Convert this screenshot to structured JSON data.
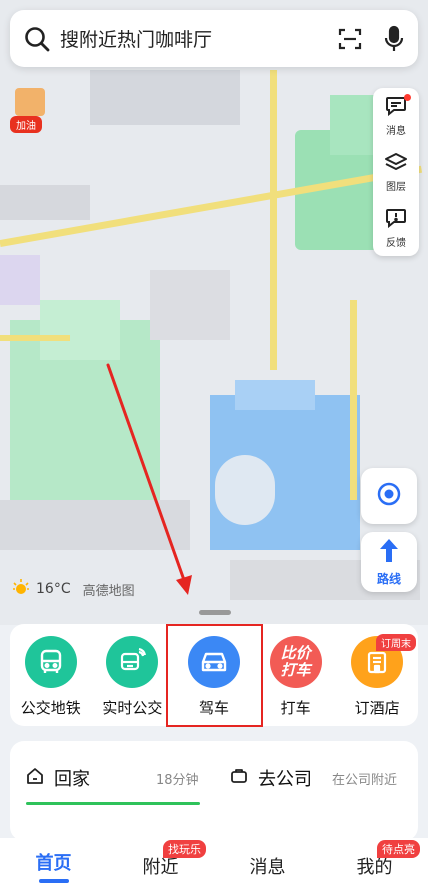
{
  "search": {
    "placeholder": "搜附近热门咖啡厅"
  },
  "map_overlay": {
    "gas_badge": "加油"
  },
  "tools": [
    {
      "label": "消息",
      "icon": "message-icon",
      "has_dot": true
    },
    {
      "label": "图层",
      "icon": "layers-icon"
    },
    {
      "label": "反馈",
      "icon": "feedback-icon"
    }
  ],
  "route_button": {
    "label": "路线"
  },
  "weather": {
    "temperature": "16°C",
    "brand": "高德地图"
  },
  "quick_access": [
    {
      "label": "公交地铁",
      "icon": "bus-icon",
      "color": "#1fc59a"
    },
    {
      "label": "实时公交",
      "icon": "realtime-bus-icon",
      "color": "#1fc59a"
    },
    {
      "label": "驾车",
      "icon": "car-icon",
      "color": "#3b88f5"
    },
    {
      "label": "打车",
      "icon": "compare-taxi-icon",
      "color": "#f25b55",
      "icon_text": "比价打车"
    },
    {
      "label": "订酒店",
      "icon": "hotel-icon",
      "color": "#ffa21b",
      "tag": "订周末"
    }
  ],
  "commute": {
    "home": {
      "label": "回家",
      "eta": "18分钟"
    },
    "work": {
      "label": "去公司",
      "hint": "在公司附近"
    }
  },
  "bottom_nav": [
    {
      "label": "首页",
      "active": true
    },
    {
      "label": "附近",
      "tag": "找玩乐"
    },
    {
      "label": "消息"
    },
    {
      "label": "我的",
      "tag": "待点亮"
    }
  ],
  "colors": {
    "accent": "#2a6ef5",
    "highlight": "#e52521"
  }
}
